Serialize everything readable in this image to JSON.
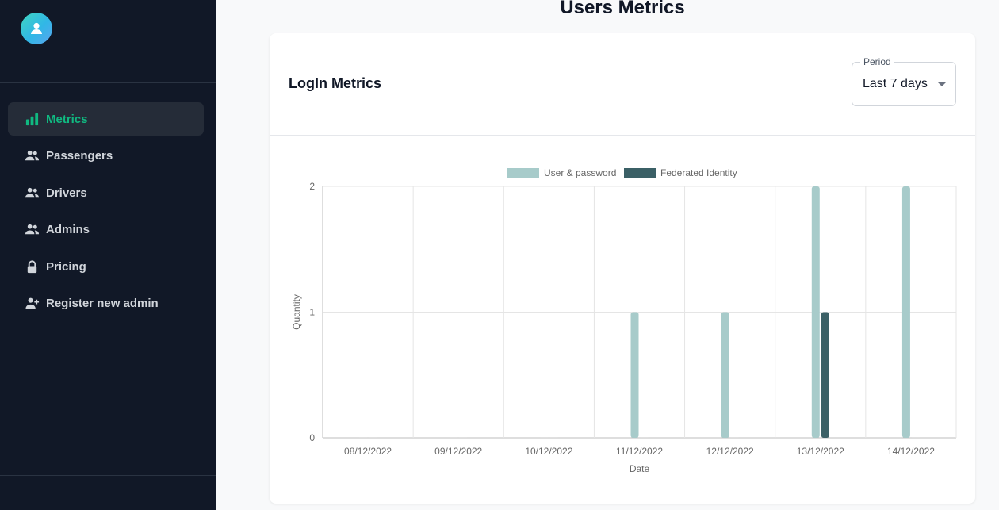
{
  "sidebar": {
    "items": [
      {
        "label": "Metrics",
        "icon": "bar-chart-icon",
        "active": true
      },
      {
        "label": "Passengers",
        "icon": "people-icon"
      },
      {
        "label": "Drivers",
        "icon": "people-icon"
      },
      {
        "label": "Admins",
        "icon": "people-icon"
      },
      {
        "label": "Pricing",
        "icon": "lock-icon"
      },
      {
        "label": "Register new admin",
        "icon": "person-add-icon"
      }
    ]
  },
  "page": {
    "title": "Users Metrics"
  },
  "card": {
    "title": "LogIn Metrics",
    "period": {
      "label": "Period",
      "value": "Last 7 days"
    }
  },
  "colors": {
    "accent": "#10b981",
    "sidebar_bg": "#111827",
    "series_user_password": "#a7cbca",
    "series_federated": "#3b6066"
  },
  "chart_data": {
    "type": "bar",
    "categories": [
      "08/12/2022",
      "09/12/2022",
      "10/12/2022",
      "11/12/2022",
      "12/12/2022",
      "13/12/2022",
      "14/12/2022"
    ],
    "series": [
      {
        "name": "User & password",
        "values": [
          0,
          0,
          0,
          1,
          1,
          2,
          2
        ],
        "color": "#a7cbca"
      },
      {
        "name": "Federated Identity",
        "values": [
          0,
          0,
          0,
          0,
          0,
          1,
          0
        ],
        "color": "#3b6066"
      }
    ],
    "xlabel": "Date",
    "ylabel": "Quantity",
    "ylim": [
      0,
      2
    ],
    "yticks": [
      "0",
      "1",
      "2"
    ],
    "legend": "top",
    "grid": true
  }
}
